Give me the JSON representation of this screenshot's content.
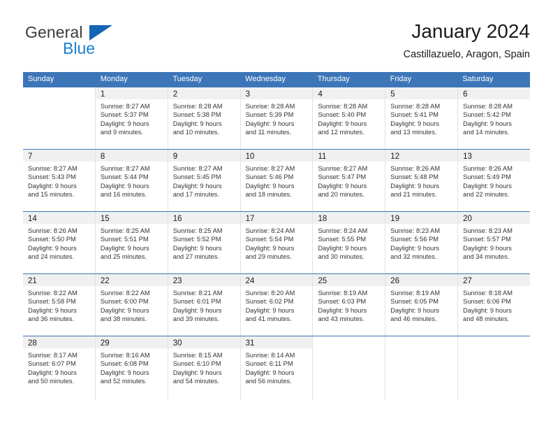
{
  "logo": {
    "word_top": "General",
    "word_bottom": "Blue",
    "triangle_color": "#1565b5",
    "blue_color": "#1b7fd0"
  },
  "header": {
    "title": "January 2024",
    "subtitle": "Castillazuelo, Aragon, Spain"
  },
  "theme": {
    "header_blue": "#3d76b8",
    "daynum_band": "#f0f0f0",
    "grid_line": "#e2e2e2"
  },
  "weekdays": [
    "Sunday",
    "Monday",
    "Tuesday",
    "Wednesday",
    "Thursday",
    "Friday",
    "Saturday"
  ],
  "weeks": [
    [
      {
        "day": "",
        "sunrise": "",
        "sunset": "",
        "daylight1": "",
        "daylight2": ""
      },
      {
        "day": "1",
        "sunrise": "Sunrise: 8:27 AM",
        "sunset": "Sunset: 5:37 PM",
        "daylight1": "Daylight: 9 hours",
        "daylight2": "and 9 minutes."
      },
      {
        "day": "2",
        "sunrise": "Sunrise: 8:28 AM",
        "sunset": "Sunset: 5:38 PM",
        "daylight1": "Daylight: 9 hours",
        "daylight2": "and 10 minutes."
      },
      {
        "day": "3",
        "sunrise": "Sunrise: 8:28 AM",
        "sunset": "Sunset: 5:39 PM",
        "daylight1": "Daylight: 9 hours",
        "daylight2": "and 11 minutes."
      },
      {
        "day": "4",
        "sunrise": "Sunrise: 8:28 AM",
        "sunset": "Sunset: 5:40 PM",
        "daylight1": "Daylight: 9 hours",
        "daylight2": "and 12 minutes."
      },
      {
        "day": "5",
        "sunrise": "Sunrise: 8:28 AM",
        "sunset": "Sunset: 5:41 PM",
        "daylight1": "Daylight: 9 hours",
        "daylight2": "and 13 minutes."
      },
      {
        "day": "6",
        "sunrise": "Sunrise: 8:28 AM",
        "sunset": "Sunset: 5:42 PM",
        "daylight1": "Daylight: 9 hours",
        "daylight2": "and 14 minutes."
      }
    ],
    [
      {
        "day": "7",
        "sunrise": "Sunrise: 8:27 AM",
        "sunset": "Sunset: 5:43 PM",
        "daylight1": "Daylight: 9 hours",
        "daylight2": "and 15 minutes."
      },
      {
        "day": "8",
        "sunrise": "Sunrise: 8:27 AM",
        "sunset": "Sunset: 5:44 PM",
        "daylight1": "Daylight: 9 hours",
        "daylight2": "and 16 minutes."
      },
      {
        "day": "9",
        "sunrise": "Sunrise: 8:27 AM",
        "sunset": "Sunset: 5:45 PM",
        "daylight1": "Daylight: 9 hours",
        "daylight2": "and 17 minutes."
      },
      {
        "day": "10",
        "sunrise": "Sunrise: 8:27 AM",
        "sunset": "Sunset: 5:46 PM",
        "daylight1": "Daylight: 9 hours",
        "daylight2": "and 18 minutes."
      },
      {
        "day": "11",
        "sunrise": "Sunrise: 8:27 AM",
        "sunset": "Sunset: 5:47 PM",
        "daylight1": "Daylight: 9 hours",
        "daylight2": "and 20 minutes."
      },
      {
        "day": "12",
        "sunrise": "Sunrise: 8:26 AM",
        "sunset": "Sunset: 5:48 PM",
        "daylight1": "Daylight: 9 hours",
        "daylight2": "and 21 minutes."
      },
      {
        "day": "13",
        "sunrise": "Sunrise: 8:26 AM",
        "sunset": "Sunset: 5:49 PM",
        "daylight1": "Daylight: 9 hours",
        "daylight2": "and 22 minutes."
      }
    ],
    [
      {
        "day": "14",
        "sunrise": "Sunrise: 8:26 AM",
        "sunset": "Sunset: 5:50 PM",
        "daylight1": "Daylight: 9 hours",
        "daylight2": "and 24 minutes."
      },
      {
        "day": "15",
        "sunrise": "Sunrise: 8:25 AM",
        "sunset": "Sunset: 5:51 PM",
        "daylight1": "Daylight: 9 hours",
        "daylight2": "and 25 minutes."
      },
      {
        "day": "16",
        "sunrise": "Sunrise: 8:25 AM",
        "sunset": "Sunset: 5:52 PM",
        "daylight1": "Daylight: 9 hours",
        "daylight2": "and 27 minutes."
      },
      {
        "day": "17",
        "sunrise": "Sunrise: 8:24 AM",
        "sunset": "Sunset: 5:54 PM",
        "daylight1": "Daylight: 9 hours",
        "daylight2": "and 29 minutes."
      },
      {
        "day": "18",
        "sunrise": "Sunrise: 8:24 AM",
        "sunset": "Sunset: 5:55 PM",
        "daylight1": "Daylight: 9 hours",
        "daylight2": "and 30 minutes."
      },
      {
        "day": "19",
        "sunrise": "Sunrise: 8:23 AM",
        "sunset": "Sunset: 5:56 PM",
        "daylight1": "Daylight: 9 hours",
        "daylight2": "and 32 minutes."
      },
      {
        "day": "20",
        "sunrise": "Sunrise: 8:23 AM",
        "sunset": "Sunset: 5:57 PM",
        "daylight1": "Daylight: 9 hours",
        "daylight2": "and 34 minutes."
      }
    ],
    [
      {
        "day": "21",
        "sunrise": "Sunrise: 8:22 AM",
        "sunset": "Sunset: 5:58 PM",
        "daylight1": "Daylight: 9 hours",
        "daylight2": "and 36 minutes."
      },
      {
        "day": "22",
        "sunrise": "Sunrise: 8:22 AM",
        "sunset": "Sunset: 6:00 PM",
        "daylight1": "Daylight: 9 hours",
        "daylight2": "and 38 minutes."
      },
      {
        "day": "23",
        "sunrise": "Sunrise: 8:21 AM",
        "sunset": "Sunset: 6:01 PM",
        "daylight1": "Daylight: 9 hours",
        "daylight2": "and 39 minutes."
      },
      {
        "day": "24",
        "sunrise": "Sunrise: 8:20 AM",
        "sunset": "Sunset: 6:02 PM",
        "daylight1": "Daylight: 9 hours",
        "daylight2": "and 41 minutes."
      },
      {
        "day": "25",
        "sunrise": "Sunrise: 8:19 AM",
        "sunset": "Sunset: 6:03 PM",
        "daylight1": "Daylight: 9 hours",
        "daylight2": "and 43 minutes."
      },
      {
        "day": "26",
        "sunrise": "Sunrise: 8:19 AM",
        "sunset": "Sunset: 6:05 PM",
        "daylight1": "Daylight: 9 hours",
        "daylight2": "and 46 minutes."
      },
      {
        "day": "27",
        "sunrise": "Sunrise: 8:18 AM",
        "sunset": "Sunset: 6:06 PM",
        "daylight1": "Daylight: 9 hours",
        "daylight2": "and 48 minutes."
      }
    ],
    [
      {
        "day": "28",
        "sunrise": "Sunrise: 8:17 AM",
        "sunset": "Sunset: 6:07 PM",
        "daylight1": "Daylight: 9 hours",
        "daylight2": "and 50 minutes."
      },
      {
        "day": "29",
        "sunrise": "Sunrise: 8:16 AM",
        "sunset": "Sunset: 6:08 PM",
        "daylight1": "Daylight: 9 hours",
        "daylight2": "and 52 minutes."
      },
      {
        "day": "30",
        "sunrise": "Sunrise: 8:15 AM",
        "sunset": "Sunset: 6:10 PM",
        "daylight1": "Daylight: 9 hours",
        "daylight2": "and 54 minutes."
      },
      {
        "day": "31",
        "sunrise": "Sunrise: 8:14 AM",
        "sunset": "Sunset: 6:11 PM",
        "daylight1": "Daylight: 9 hours",
        "daylight2": "and 56 minutes."
      },
      {
        "day": "",
        "sunrise": "",
        "sunset": "",
        "daylight1": "",
        "daylight2": ""
      },
      {
        "day": "",
        "sunrise": "",
        "sunset": "",
        "daylight1": "",
        "daylight2": ""
      },
      {
        "day": "",
        "sunrise": "",
        "sunset": "",
        "daylight1": "",
        "daylight2": ""
      }
    ]
  ]
}
